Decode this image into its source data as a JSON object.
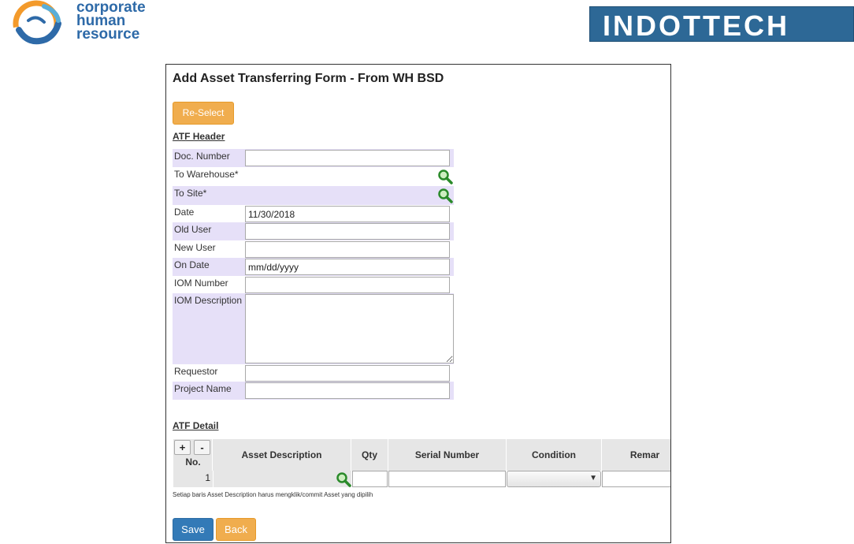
{
  "header": {
    "left_logo_lines": [
      "corporate",
      "human",
      "resource"
    ],
    "right_logo_text": "INDOTTECH"
  },
  "form": {
    "title": "Add Asset Transferring Form - From WH BSD",
    "reselect_label": "Re-Select",
    "header_section_title": "ATF Header",
    "fields": {
      "doc_number": {
        "label": "Doc. Number",
        "value": ""
      },
      "to_warehouse": {
        "label": "To Warehouse*",
        "value": ""
      },
      "to_site": {
        "label": "To Site*",
        "value": ""
      },
      "date": {
        "label": "Date",
        "value": "11/30/2018"
      },
      "old_user": {
        "label": "Old User",
        "value": ""
      },
      "new_user": {
        "label": "New User",
        "value": ""
      },
      "on_date": {
        "label": "On Date",
        "value": "mm/dd/yyyy"
      },
      "iom_number": {
        "label": "IOM Number",
        "value": ""
      },
      "iom_description": {
        "label": "IOM Description",
        "value": ""
      },
      "requestor": {
        "label": "Requestor",
        "value": ""
      },
      "project_name": {
        "label": "Project Name",
        "value": ""
      }
    },
    "detail_section_title": "ATF Detail",
    "detail": {
      "add_label": "+",
      "remove_label": "-",
      "columns": [
        "No.",
        "Asset Description",
        "Qty",
        "Serial Number",
        "Condition",
        "Remar"
      ],
      "rows": [
        {
          "no": "1",
          "asset_description": "",
          "qty": "",
          "serial_number": "",
          "condition": "",
          "remarks": ""
        }
      ]
    },
    "note": "Setiap baris Asset Description harus mengklik/commit Asset yang dipilih",
    "save_label": "Save",
    "back_label": "Back"
  },
  "colors": {
    "row_highlight": "#e6e0f8",
    "orange_button": "#f0ad4e",
    "blue_button": "#337ab7",
    "brand_blue": "#2d6896",
    "table_header": "#e6e6e6"
  },
  "icons": [
    "logo-hands-icon",
    "search-icon",
    "dropdown-arrow-icon"
  ]
}
